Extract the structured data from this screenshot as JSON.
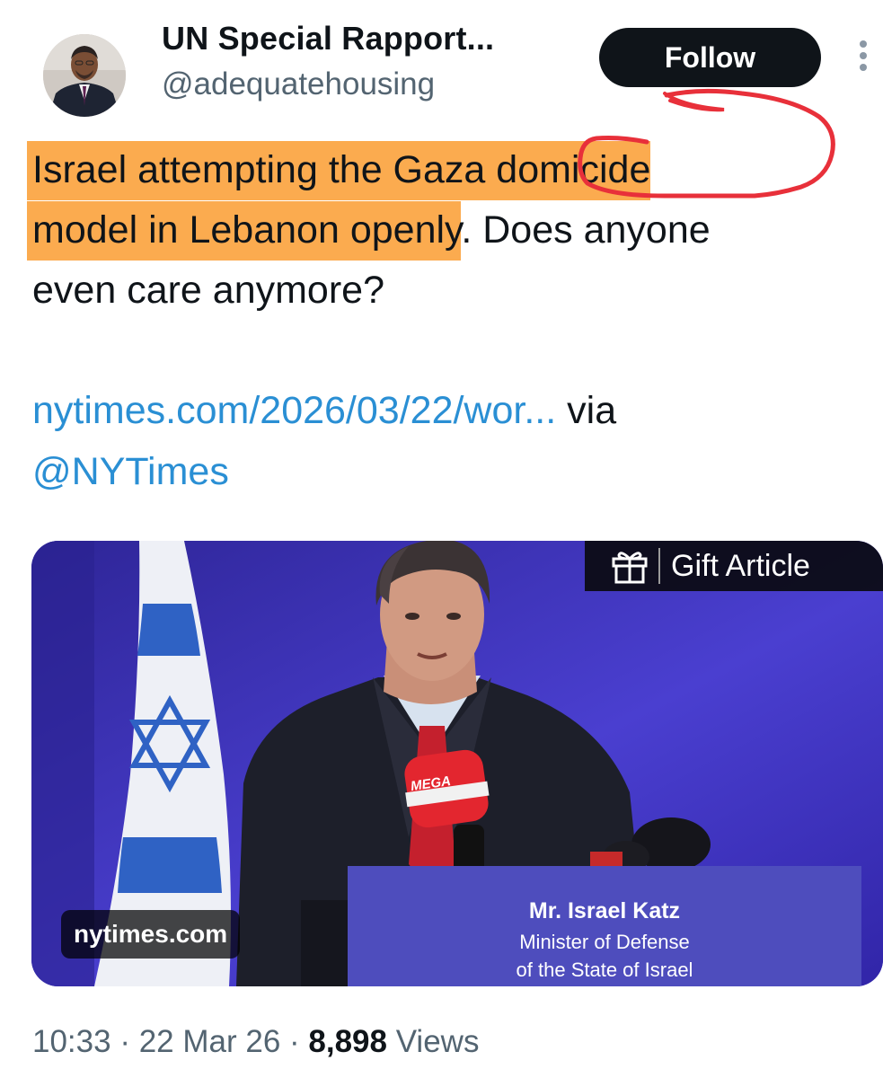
{
  "author": {
    "display_name": "UN Special Rapport...",
    "handle": "@adequatehousing",
    "follow_label": "Follow"
  },
  "tweet": {
    "highlighted_segments": [
      "Israel attempting the Gaza domicide",
      "model in Lebanon openly"
    ],
    "text_after_highlight": ". Does anyone",
    "text_line_3": "even care anymore?",
    "link_text": "nytimes.com/2026/03/22/wor...",
    "via_text": " via",
    "mention": "@NYTimes"
  },
  "media_card": {
    "gift_label": "Gift Article",
    "source_label": "nytimes.com",
    "podium_line_1": "Mr. Israel Katz",
    "podium_line_2": "Minister of Defense",
    "podium_line_3": "of the State of Israel",
    "mic_brand": "MEGA"
  },
  "meta": {
    "time": "10:33",
    "separator": " · ",
    "date": "22 Mar 26",
    "views_count": "8,898",
    "views_label": " Views"
  },
  "colors": {
    "highlight": "#fbab4f",
    "annotation_red": "#e8303a",
    "link": "#2a8fd4",
    "follow_bg": "#0f1419"
  }
}
